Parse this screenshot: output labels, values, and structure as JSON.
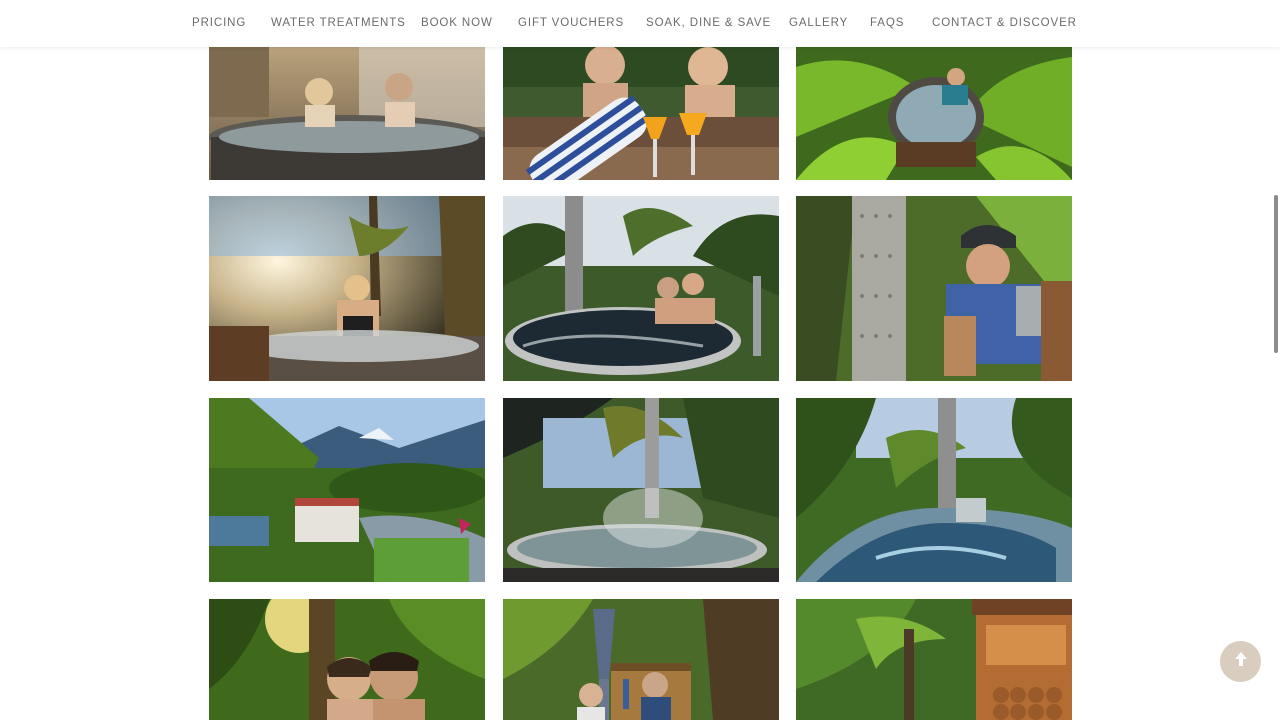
{
  "nav": {
    "items": [
      {
        "label": "PRICING"
      },
      {
        "label": "WATER TREATMENTS"
      },
      {
        "label": "BOOK NOW"
      },
      {
        "label": "GIFT VOUCHERS"
      },
      {
        "label": "SOAK, DINE & SAVE"
      },
      {
        "label": "GALLERY"
      },
      {
        "label": "FAQS"
      },
      {
        "label": "CONTACT & DISCOVER"
      }
    ],
    "text_color": "#6b6b6b"
  },
  "gallery": {
    "photos": [
      {
        "subject": "couple-in-hot-tub"
      },
      {
        "subject": "couple-with-towels-and-juice"
      },
      {
        "subject": "man-in-tub-among-ferns"
      },
      {
        "subject": "woman-in-steaming-tub"
      },
      {
        "subject": "couple-in-tub-under-palms"
      },
      {
        "subject": "man-stoking-fire"
      },
      {
        "subject": "aerial-view-with-mountains"
      },
      {
        "subject": "steaming-tub-under-palms"
      },
      {
        "subject": "tub-in-rainforest"
      },
      {
        "subject": "couple-in-forest-sunlight"
      },
      {
        "subject": "couple-by-umbrella"
      },
      {
        "subject": "firewood-shed-in-ferns"
      }
    ]
  },
  "controls": {
    "scroll_to_top_icon": "arrow-up-icon",
    "accent_color": "#d8cdbf"
  }
}
